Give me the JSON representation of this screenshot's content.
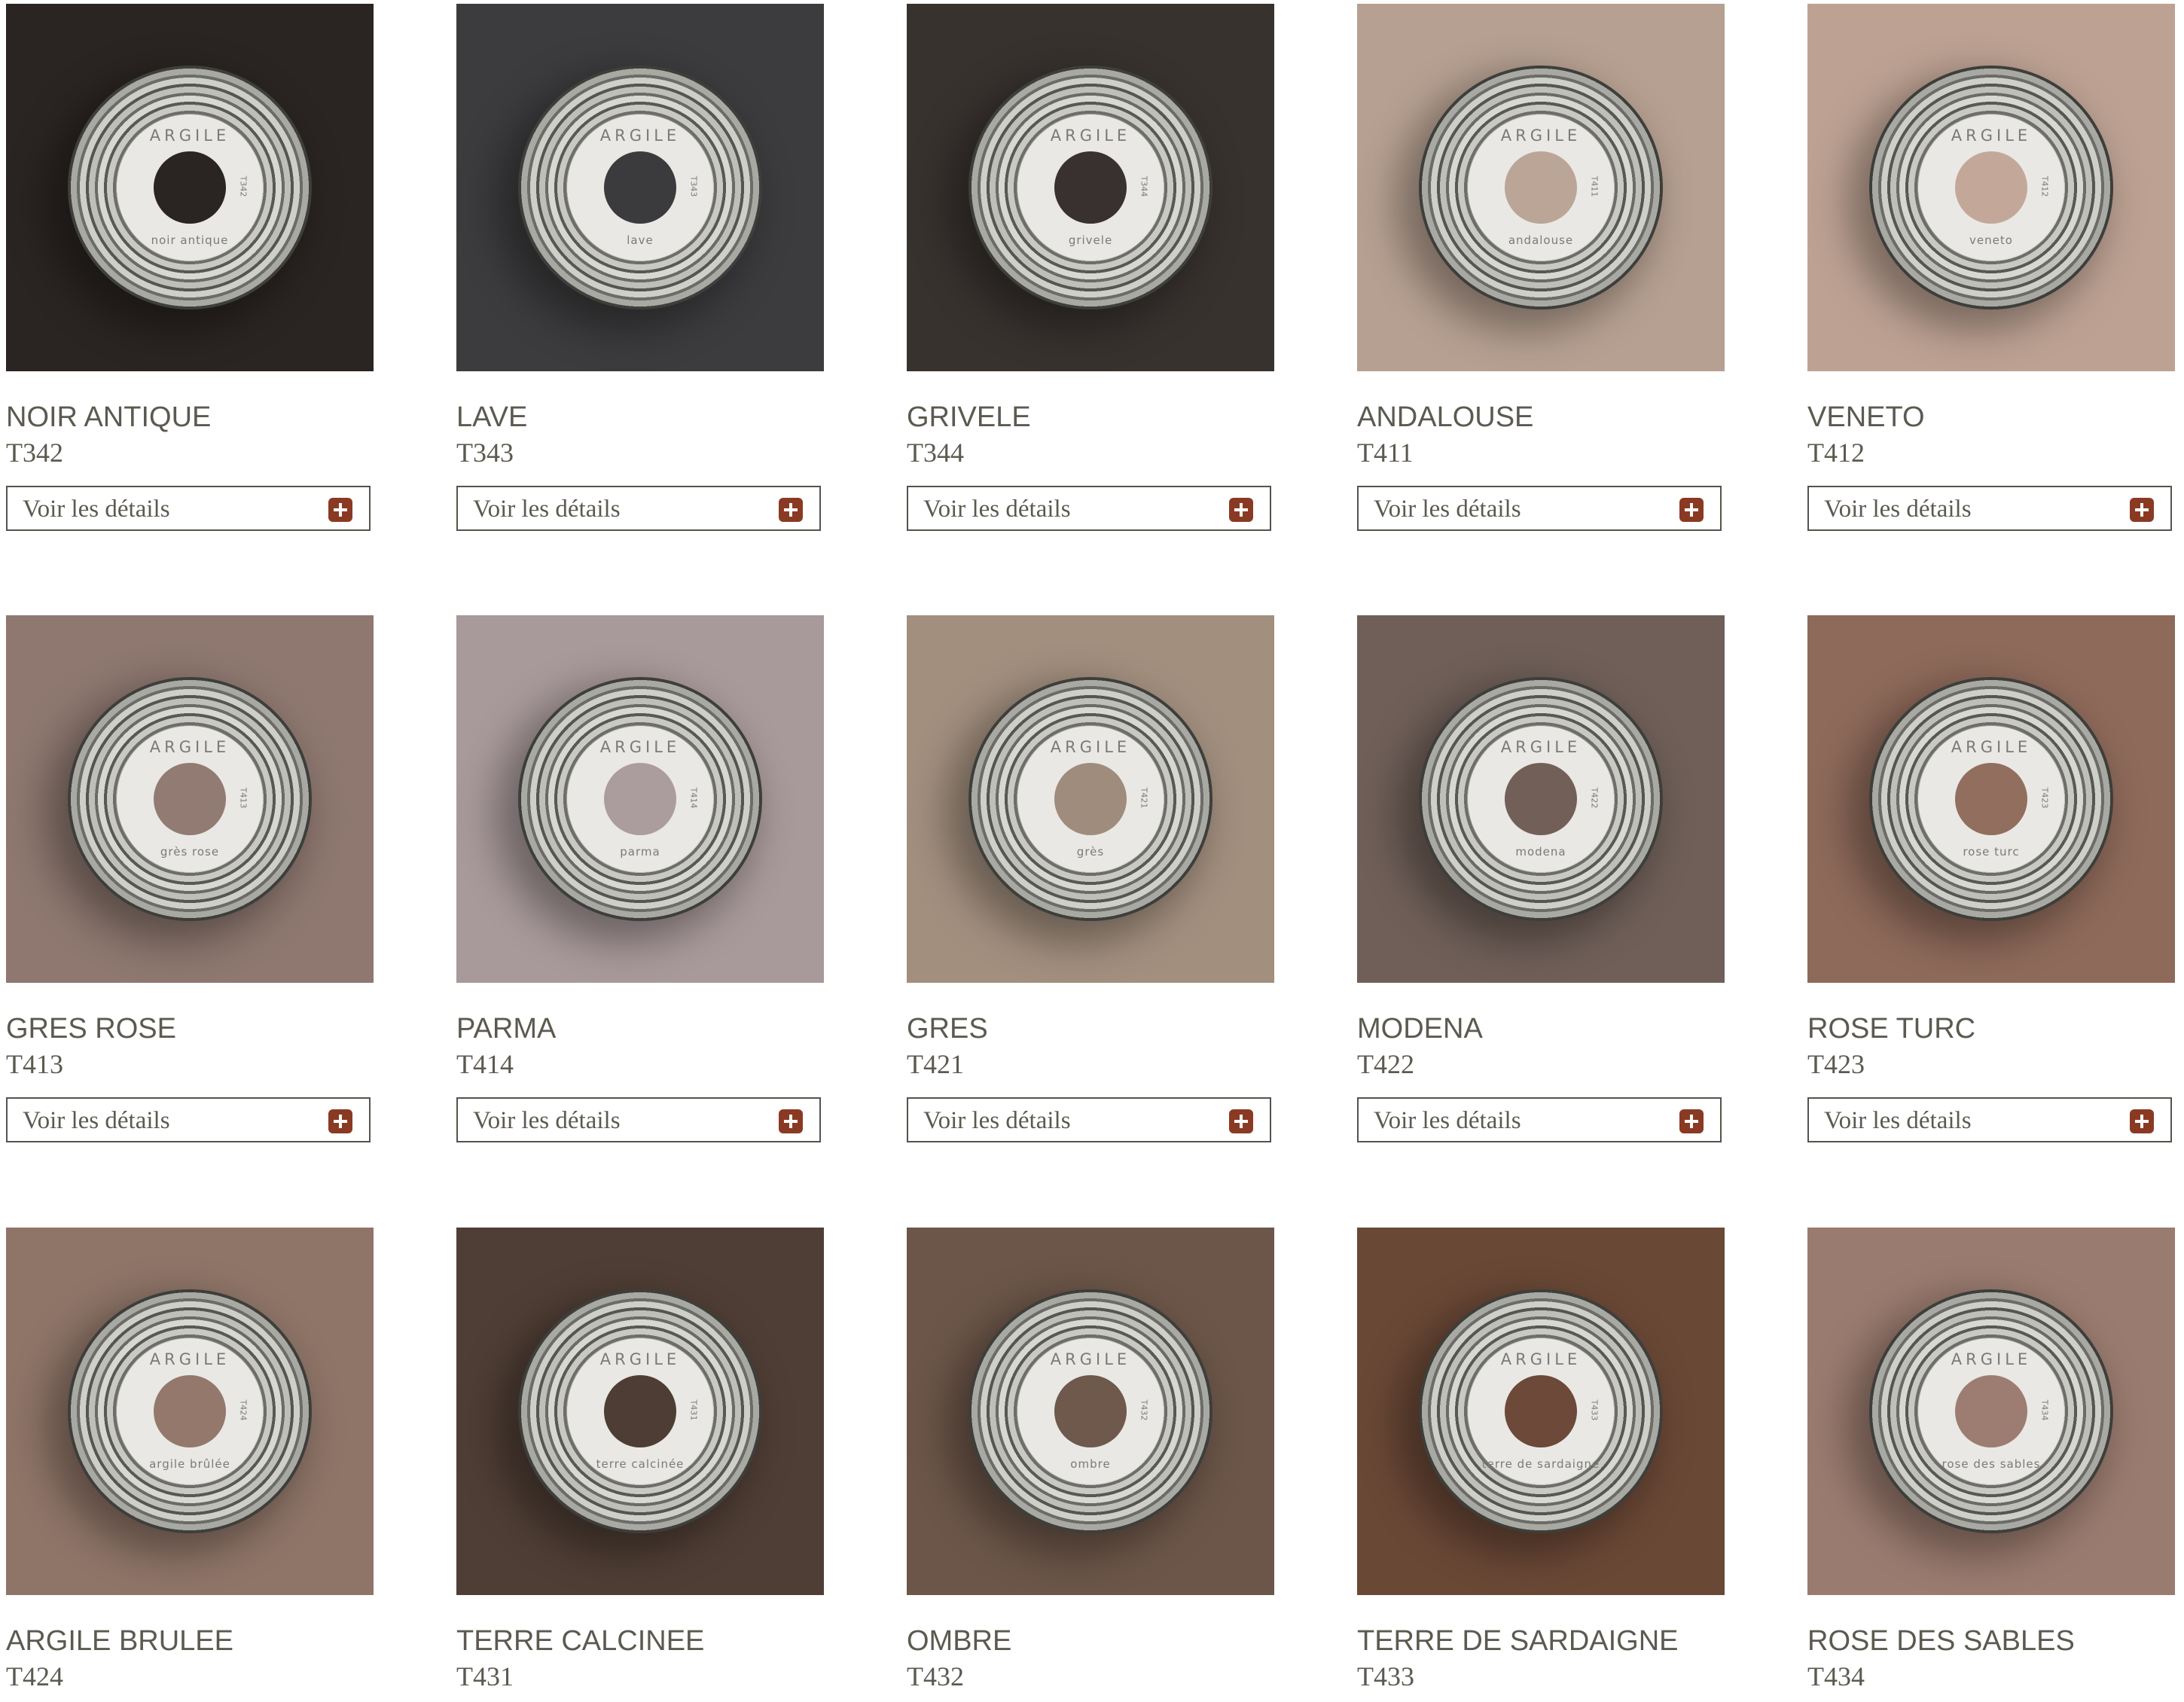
{
  "brand": "ARGILE",
  "details_label": "Voir les détails",
  "products": [
    {
      "name": "NOIR ANTIQUE",
      "code": "T342",
      "label_name": "noir antique",
      "color": "#2a2422",
      "hole_color": "#2a2422"
    },
    {
      "name": "LAVE",
      "code": "T343",
      "label_name": "lave",
      "color": "#3c3c3e",
      "hole_color": "#3b3b3d"
    },
    {
      "name": "GRIVELE",
      "code": "T344",
      "label_name": "grivele",
      "color": "#38322f",
      "hole_color": "#39312f"
    },
    {
      "name": "ANDALOUSE",
      "code": "T411",
      "label_name": "andalouse",
      "color": "#b6a091",
      "hole_color": "#bba596"
    },
    {
      "name": "VENETO",
      "code": "T412",
      "label_name": "veneto",
      "color": "#bda293",
      "hole_color": "#c3a899"
    },
    {
      "name": "GRES ROSE",
      "code": "T413",
      "label_name": "grès rose",
      "color": "#8e7870",
      "hole_color": "#927b73"
    },
    {
      "name": "PARMA",
      "code": "T414",
      "label_name": "parma",
      "color": "#a8999a",
      "hole_color": "#ab9c9d"
    },
    {
      "name": "GRES",
      "code": "T421",
      "label_name": "grès",
      "color": "#a28f7e",
      "hole_color": "#a08c7c"
    },
    {
      "name": "MODENA",
      "code": "T422",
      "label_name": "modena",
      "color": "#6f5f58",
      "hole_color": "#725f58"
    },
    {
      "name": "ROSE TURC",
      "code": "T423",
      "label_name": "rose turc",
      "color": "#8e6a5a",
      "hole_color": "#926e5e"
    },
    {
      "name": "ARGILE BRULEE",
      "code": "T424",
      "label_name": "argile brûlée",
      "color": "#8f7568",
      "hole_color": "#93786b"
    },
    {
      "name": "TERRE CALCINEE",
      "code": "T431",
      "label_name": "terre calcinée",
      "color": "#4f3e35",
      "hole_color": "#4e3d34"
    },
    {
      "name": "OMBRE",
      "code": "T432",
      "label_name": "ombre",
      "color": "#6c5649",
      "hole_color": "#6f584c"
    },
    {
      "name": "TERRE DE SARDAIGNE",
      "code": "T433",
      "label_name": "terre de sardaigne",
      "color": "#6a4836",
      "hole_color": "#6c4938"
    },
    {
      "name": "ROSE DES SABLES",
      "code": "T434",
      "label_name": "rose des sables",
      "color": "#9a7b6f",
      "hole_color": "#9d7d71"
    }
  ]
}
